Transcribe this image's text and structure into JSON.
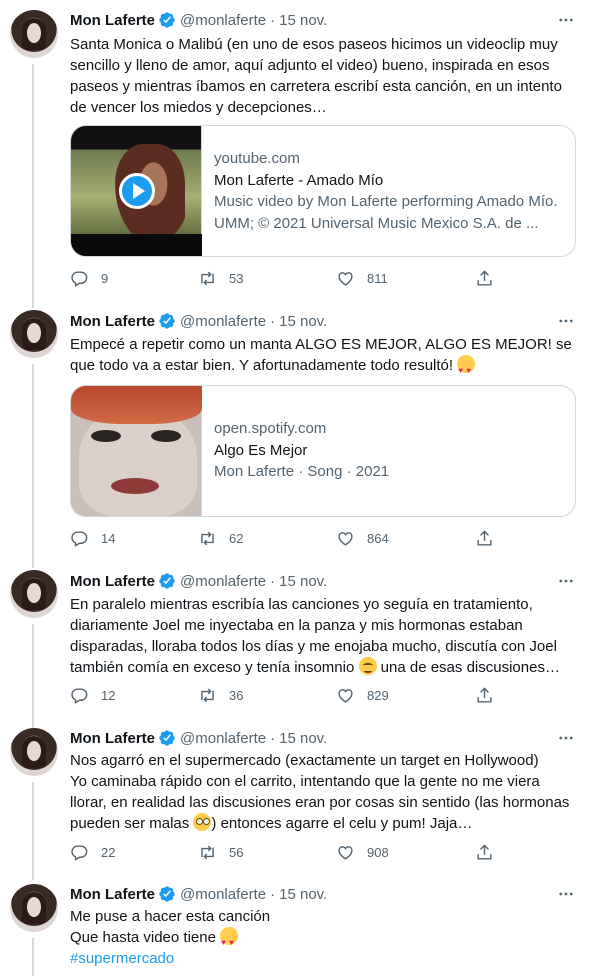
{
  "tweets": [
    {
      "name": "Mon Laferte",
      "handle": "@monlaferte",
      "date": "15 nov.",
      "text_lines": [
        "Santa Monica o Malibú (en uno de esos paseos hicimos un videoclip muy",
        "sencillo y lleno de amor, aquí adjunto el video) bueno, inspirada en esos",
        "paseos y mientras íbamos en carretera escribí esta canción, en un intento",
        "de vencer los miedos y decepciones…"
      ],
      "card": {
        "domain": "youtube.com",
        "title": "Mon Laferte - Amado Mío",
        "desc_lines": [
          "Music video by Mon Laferte performing Amado Mío.",
          "UMM; © 2021 Universal Music Mexico S.A. de ..."
        ]
      },
      "replies": "9",
      "retweets": "53",
      "likes": "811"
    },
    {
      "name": "Mon Laferte",
      "handle": "@monlaferte",
      "date": "15 nov.",
      "text_lines": [
        "Empecé a repetir como un manta ALGO ES MEJOR, ALGO ES MEJOR! se",
        "que todo va a estar bien. Y afortunadamente todo resultó!"
      ],
      "card": {
        "domain": "open.spotify.com",
        "title": "Algo Es Mejor",
        "desc_lines": [
          "Mon Laferte · Song · 2021"
        ]
      },
      "replies": "14",
      "retweets": "62",
      "likes": "864"
    },
    {
      "name": "Mon Laferte",
      "handle": "@monlaferte",
      "date": "15 nov.",
      "text_lines": [
        "En paralelo mientras escribía las canciones yo seguía en tratamiento,",
        "diariamente Joel me inyectaba en la panza y mis hormonas estaban",
        "disparadas, lloraba todos los días y me enojaba mucho, discutía con Joel",
        "también comía en exceso y tenía insomnio",
        " una de esas discusiones…"
      ],
      "replies": "12",
      "retweets": "36",
      "likes": "829"
    },
    {
      "name": "Mon Laferte",
      "handle": "@monlaferte",
      "date": "15 nov.",
      "text_lines": [
        "Nos agarró en el supermercado (exactamente un target en Hollywood)",
        "Yo caminaba rápido con el carrito, intentando que la gente no me viera",
        "llorar, en realidad las discusiones eran por cosas sin sentido (las hormonas",
        "pueden ser malas",
        ")  entonces agarre el celu y pum! Jaja…"
      ],
      "replies": "22",
      "retweets": "56",
      "likes": "908"
    },
    {
      "name": "Mon Laferte",
      "handle": "@monlaferte",
      "date": "15 nov.",
      "text_lines": [
        "Me puse a hacer esta canción",
        "Que hasta video tiene"
      ],
      "hashtag": "#supermercado"
    }
  ],
  "colors": {
    "accent": "#1d9bf0",
    "text": "#0f1419",
    "muted": "#536471",
    "border": "#cfd9de"
  },
  "icons": [
    "verified-badge-icon",
    "more-icon",
    "reply-icon",
    "retweet-icon",
    "like-icon",
    "share-icon",
    "play-icon"
  ]
}
